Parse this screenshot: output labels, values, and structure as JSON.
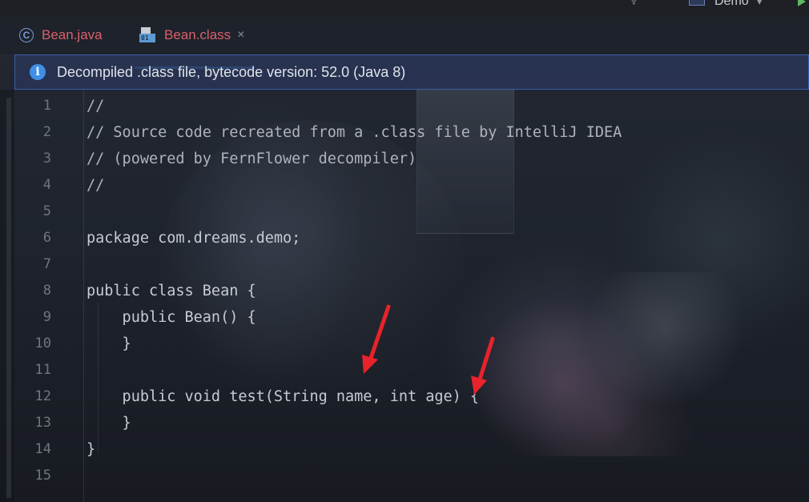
{
  "topbar": {
    "project_name": "Demo",
    "project_dropdown": "▾"
  },
  "tabs": [
    {
      "label": "Bean.java",
      "icon": "class-c-icon"
    },
    {
      "label": "Bean.class",
      "icon": "class-file-icon",
      "icon_text": "01",
      "close": "×",
      "active": true
    }
  ],
  "banner": {
    "icon": "i",
    "message": "Decompiled .class file, bytecode version: 52.0 (Java 8)"
  },
  "code": [
    {
      "ln": "1",
      "text": "//"
    },
    {
      "ln": "2",
      "text": "// Source code recreated from a .class file by IntelliJ IDEA"
    },
    {
      "ln": "3",
      "text": "// (powered by FernFlower decompiler)"
    },
    {
      "ln": "4",
      "text": "//"
    },
    {
      "ln": "5",
      "text": ""
    },
    {
      "ln": "6",
      "text": "package com.dreams.demo;"
    },
    {
      "ln": "7",
      "text": ""
    },
    {
      "ln": "8",
      "text": "public class Bean {"
    },
    {
      "ln": "9",
      "text": "    public Bean() {"
    },
    {
      "ln": "10",
      "text": "    }"
    },
    {
      "ln": "11",
      "text": ""
    },
    {
      "ln": "12",
      "text": "    public void test(String name, int age) {"
    },
    {
      "ln": "13",
      "text": "    }"
    },
    {
      "ln": "14",
      "text": "}"
    },
    {
      "ln": "15",
      "text": ""
    }
  ],
  "colors": {
    "tab_label": "#d9606c",
    "banner_bg": "#2a3658",
    "info_icon": "#3f8fe6",
    "arrow": "#e8232b",
    "active_tab_underline": "#3d8fd9"
  }
}
